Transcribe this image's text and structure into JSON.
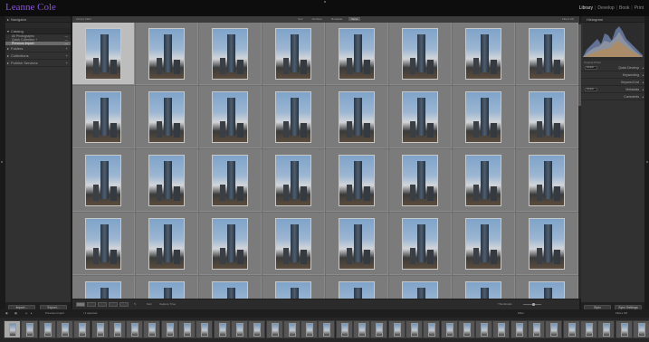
{
  "identity_plate": "Leanne Cole",
  "modules": [
    "Library",
    "Develop",
    "Book",
    "Print"
  ],
  "active_module": "Library",
  "colors": {
    "identity_plate": "#8a52d8",
    "grid_background": "#6e6e6e",
    "selected_cell": "#bdbdbd"
  },
  "left_panel": {
    "navigator": "Navigator",
    "catalog": "Catalog",
    "catalog_rows": [
      {
        "label": "All Photographs",
        "count": "—"
      },
      {
        "label": "Quick Collection +",
        "count": "—"
      },
      {
        "label": "Previous Import",
        "count": "—"
      }
    ],
    "sections": [
      "Folders",
      "Collections",
      "Publish Services"
    ],
    "buttons": {
      "import": "Import...",
      "export": "Export..."
    }
  },
  "right_panel": {
    "histogram": "Histogram",
    "original_photo": "Original Photo",
    "rows": [
      {
        "select": "Default",
        "label": "Quick Develop"
      },
      {
        "select": "",
        "label": "Keywording"
      },
      {
        "select": "",
        "label": "Keyword List"
      },
      {
        "select": "Default",
        "label": "Metadata"
      },
      {
        "select": "",
        "label": "Comments"
      }
    ],
    "buttons": {
      "sync": "Sync",
      "sync_settings": "Sync Settings"
    }
  },
  "filter_bar": {
    "label": "Library Filter :",
    "tabs": [
      "Text",
      "Attribute",
      "Metadata",
      "None"
    ],
    "active_tab": "None",
    "preset": "Filters Off"
  },
  "grid": {
    "columns": 8,
    "rows": 5,
    "selected_index": 0,
    "thumbnail_icon": "photo-thumbnail-icon"
  },
  "toolbar": {
    "sort_label": "Sort:",
    "sort_value": "Capture Time",
    "thumbnails_label": "Thumbnails"
  },
  "filmstrip": {
    "source": "Previous Import",
    "status": "/ 1 selected",
    "filter_label": "Filter:",
    "filter_value": "Filters Off",
    "thumb_count": 37,
    "selected_index": 0
  }
}
